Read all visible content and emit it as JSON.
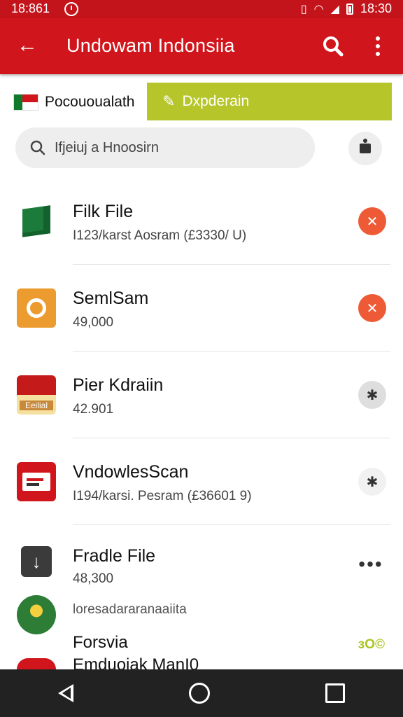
{
  "status_bar": {
    "time_left": "18:861",
    "time_right": "18:30",
    "icons": [
      "alarm-icon",
      "vibrate-icon",
      "wifi-icon",
      "signal-icon",
      "battery-icon"
    ]
  },
  "app_bar": {
    "title": "Undowam Indonsiia",
    "icons": [
      "arrow-back-icon",
      "search-icon",
      "more-vert-icon"
    ],
    "color": "#d0161c"
  },
  "tabs": {
    "language_label": "Pocououalath",
    "action_label": "Dxpderain",
    "action_color": "#b5c52a"
  },
  "search": {
    "value": "Ifjeiuj a Hnoosirn"
  },
  "items": [
    {
      "name": "Filk File",
      "meta": "I123/karst Aosram (£3330/ U)",
      "action": "x"
    },
    {
      "name": "SemlSam",
      "meta": "49,000",
      "action": "x"
    },
    {
      "name": "Pier Kdraiin",
      "meta": "42.901",
      "icon_text": "Eeilial",
      "action": "✱"
    },
    {
      "name": "VndowlesScan",
      "meta": "I194/karsi. Pesram (£36601 9)",
      "action": "✱"
    },
    {
      "name": "Fradle File",
      "meta": "48,300",
      "action": "•••"
    }
  ],
  "extra": {
    "subtitle": "loresadararanaaiita",
    "name": "Forsvia",
    "name2": "Emduojak ManI0",
    "score": "ɜO©"
  },
  "nav": [
    "back-icon",
    "home-icon",
    "recents-icon"
  ]
}
